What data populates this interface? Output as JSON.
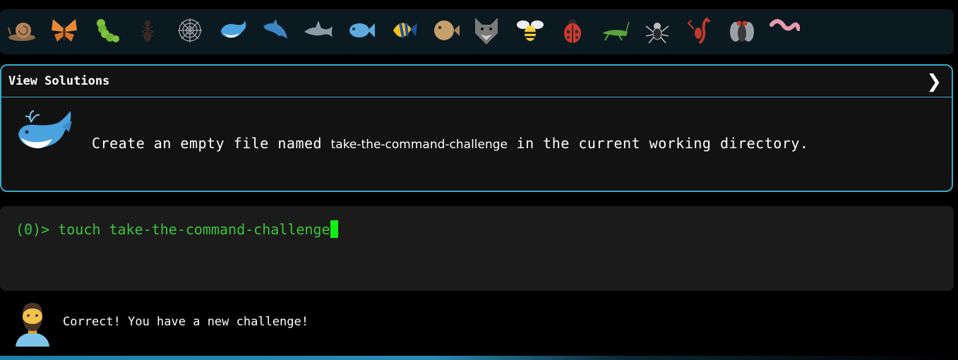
{
  "icon_bar": {
    "icons": [
      {
        "name": "snail-icon",
        "color": "#b5835a"
      },
      {
        "name": "butterfly-icon",
        "color": "#e88a38"
      },
      {
        "name": "caterpillar-icon",
        "color": "#7fc241"
      },
      {
        "name": "ant-icon",
        "color": "#3b2a22"
      },
      {
        "name": "spider-web-icon",
        "color": "#9a9a9a"
      },
      {
        "name": "whale-icon",
        "color": "#4aa3df"
      },
      {
        "name": "dolphin-icon",
        "color": "#3d86c6"
      },
      {
        "name": "shark-icon",
        "color": "#8a9aa6"
      },
      {
        "name": "fish-icon",
        "color": "#5fa8dc"
      },
      {
        "name": "tropical-fish-icon",
        "color": "#f2c21b"
      },
      {
        "name": "blowfish-icon",
        "color": "#c4a06a"
      },
      {
        "name": "wolf-icon",
        "color": "#7a7a7a"
      },
      {
        "name": "bee-icon",
        "color": "#f7d03c"
      },
      {
        "name": "ladybug-icon",
        "color": "#d23a2f"
      },
      {
        "name": "cricket-icon",
        "color": "#5aa53a"
      },
      {
        "name": "spider-icon",
        "color": "#2b2b2b"
      },
      {
        "name": "scorpion-icon",
        "color": "#c0392b"
      },
      {
        "name": "fly-icon",
        "color": "#5c5c5c"
      },
      {
        "name": "worm-icon",
        "color": "#e79ab0"
      }
    ]
  },
  "solutions_panel": {
    "title": "View Solutions",
    "chevron": "❯",
    "challenge_icon": "whale-icon",
    "challenge_prefix": "Create an empty file named ",
    "challenge_filename": "take-the-command-challenge",
    "challenge_suffix": " in the current working directory."
  },
  "terminal": {
    "prompt": "(0)> ",
    "command": "touch take-the-command-challenge",
    "text_color": "#3ec33e",
    "cursor_color": "#12ef12"
  },
  "feedback": {
    "avatar_icon": "man-avatar-icon",
    "message": "Correct! You have a new challenge!"
  },
  "colors": {
    "accent": "#3aa8c8",
    "background": "#000000",
    "panel_background": "#121212"
  }
}
